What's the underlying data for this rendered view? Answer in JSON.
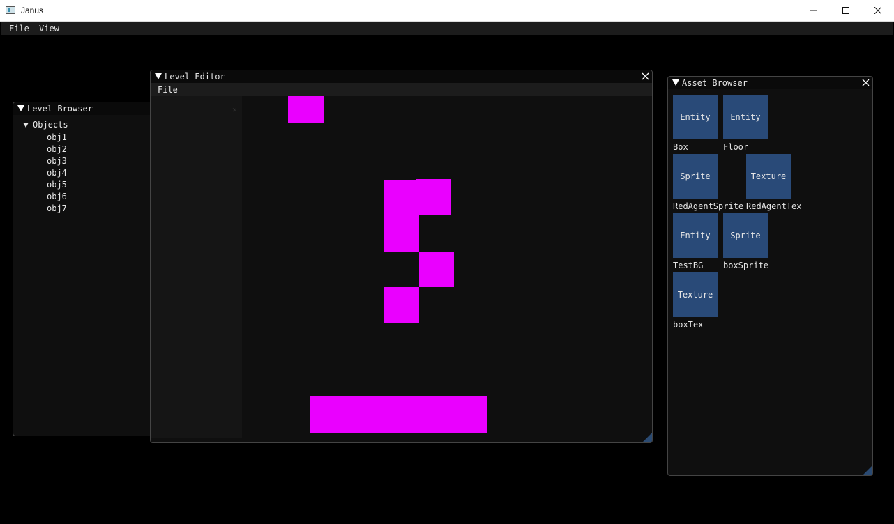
{
  "window": {
    "title": "Janus",
    "controls": [
      "minimize-icon",
      "maximize-icon",
      "close-icon"
    ]
  },
  "menubar": {
    "items": [
      "File",
      "View"
    ]
  },
  "level_browser": {
    "title": "Level Browser",
    "root_label": "Objects",
    "objects": [
      "obj1",
      "obj2",
      "obj3",
      "obj4",
      "obj5",
      "obj6",
      "obj7"
    ]
  },
  "level_editor": {
    "title": "Level Editor",
    "menu": {
      "file": "File"
    },
    "tile_color": "#ea00ff"
  },
  "asset_browser": {
    "title": "Asset Browser",
    "assets": [
      {
        "type": "Entity",
        "name": "Box"
      },
      {
        "type": "Entity",
        "name": "Floor"
      },
      {
        "type": "Sprite",
        "name": "RedAgentSprite"
      },
      {
        "type": "Texture",
        "name": "RedAgentTex"
      },
      {
        "type": "Entity",
        "name": "TestBG"
      },
      {
        "type": "Sprite",
        "name": "boxSprite"
      },
      {
        "type": "Texture",
        "name": "boxTex"
      }
    ]
  },
  "colors": {
    "background": "#000000",
    "panel_bg": "#0f0f0f",
    "asset_tile": "#294a78",
    "accent_magenta": "#ea00ff"
  }
}
